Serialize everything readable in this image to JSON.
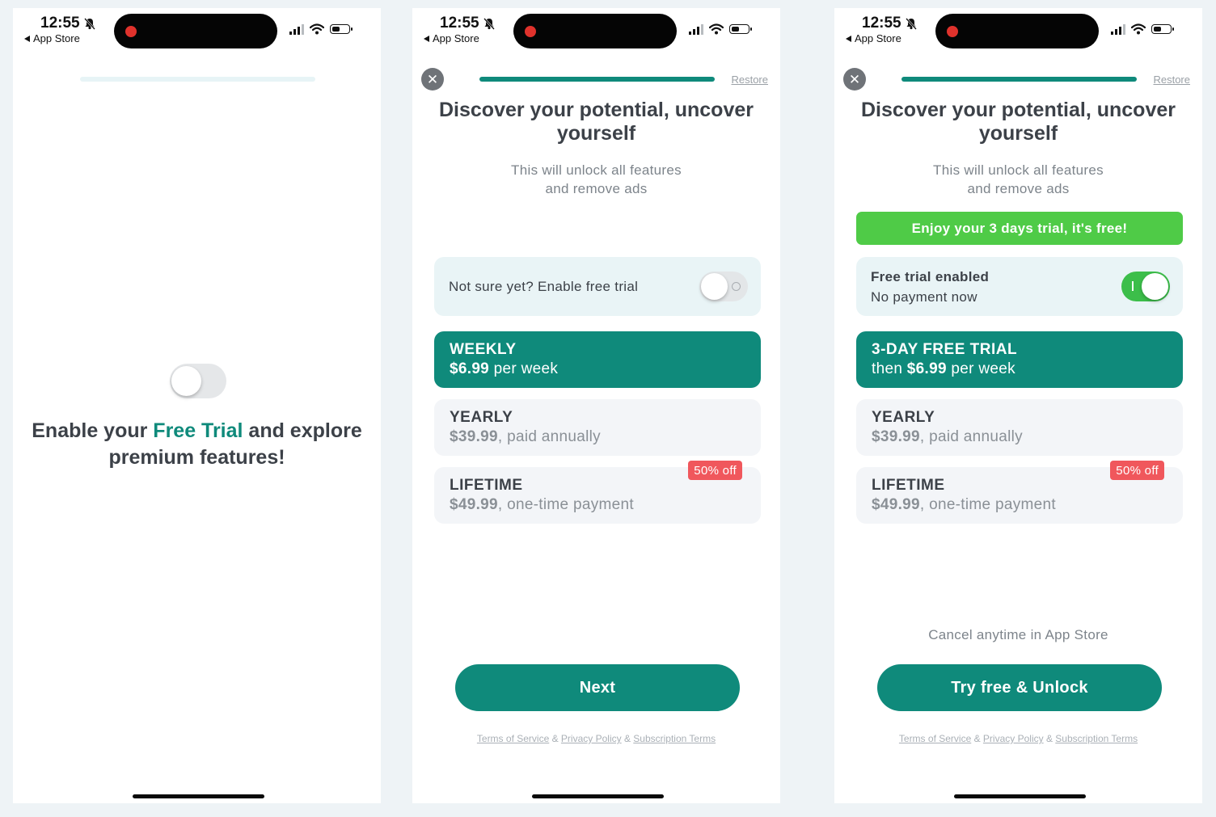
{
  "status_bar": {
    "time": "12:55",
    "back_label": "App Store"
  },
  "colors": {
    "accent": "#0f8a7b",
    "trial_green": "#4fcb47",
    "discount_red": "#f0575c",
    "recording_red": "#e0322c"
  },
  "screen1": {
    "promo_before": "Enable your ",
    "promo_accent": "Free Trial",
    "promo_after": " and explore premium features!",
    "toggle_on": false
  },
  "screen2": {
    "restore": "Restore",
    "title": "Discover your potential, uncover yourself",
    "subtitle_line1": "This will unlock all features",
    "subtitle_line2": "and remove ads",
    "toggle_label": "Not sure yet? Enable free trial",
    "toggle_on": false,
    "plans": [
      {
        "name": "WEEKLY",
        "amount": "$6.99",
        "suffix": " per week",
        "selected": true
      },
      {
        "name": "YEARLY",
        "amount": "$39.99",
        "suffix": ", paid annually",
        "selected": false
      },
      {
        "name": "LIFETIME",
        "amount": "$49.99",
        "suffix": ", one-time payment",
        "selected": false,
        "badge": "50% off"
      }
    ],
    "cta": "Next"
  },
  "screen3": {
    "restore": "Restore",
    "title": "Discover your potential, uncover yourself",
    "subtitle_line1": "This will unlock all features",
    "subtitle_line2": "and remove ads",
    "trial_banner": "Enjoy your 3 days trial, it's free!",
    "toggle_line1": "Free trial enabled",
    "toggle_line2": "No payment now",
    "toggle_on": true,
    "plans": [
      {
        "name": "3-DAY FREE TRIAL",
        "prefix": "then ",
        "amount": "$6.99",
        "suffix": " per week",
        "selected": true
      },
      {
        "name": "YEARLY",
        "amount": "$39.99",
        "suffix": ", paid annually",
        "selected": false
      },
      {
        "name": "LIFETIME",
        "amount": "$49.99",
        "suffix": ", one-time payment",
        "selected": false,
        "badge": "50% off"
      }
    ],
    "cancel_note": "Cancel anytime in App Store",
    "cta": "Try free & Unlock"
  },
  "legal": {
    "terms": "Terms of Service",
    "amp1": " & ",
    "privacy": "Privacy Policy",
    "amp2": " & ",
    "subscription": "Subscription Terms"
  }
}
